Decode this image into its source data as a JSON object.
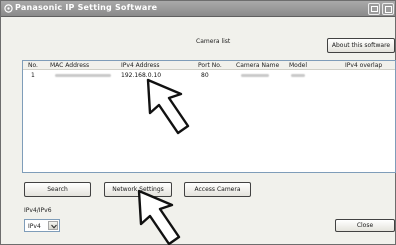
{
  "window": {
    "title": "Panasonic IP Setting Software",
    "buttons": [
      "minimize-icon",
      "restore-icon"
    ]
  },
  "camera_list": {
    "caption": "Camera list",
    "columns": [
      "No.",
      "MAC Address",
      "IPv4 Address",
      "Port No.",
      "Camera Name",
      "Model",
      "IPv4 overlap"
    ],
    "rows": [
      {
        "no": "1",
        "mac": "",
        "ipv4": "192.168.0.10",
        "port": "80",
        "camera_name": "",
        "model": "",
        "overlap": ""
      }
    ]
  },
  "toolbar": {
    "about_label": "About this software",
    "search_label": "Search",
    "network_label": "Network Settings",
    "access_label": "Access Camera",
    "close_label": "Close"
  },
  "ip_mode": {
    "label": "IPv4/IPv6",
    "selected": "IPv4"
  },
  "icons": {
    "pointers": [
      "pointer-arrow-icon",
      "pointer-arrow-icon"
    ]
  }
}
